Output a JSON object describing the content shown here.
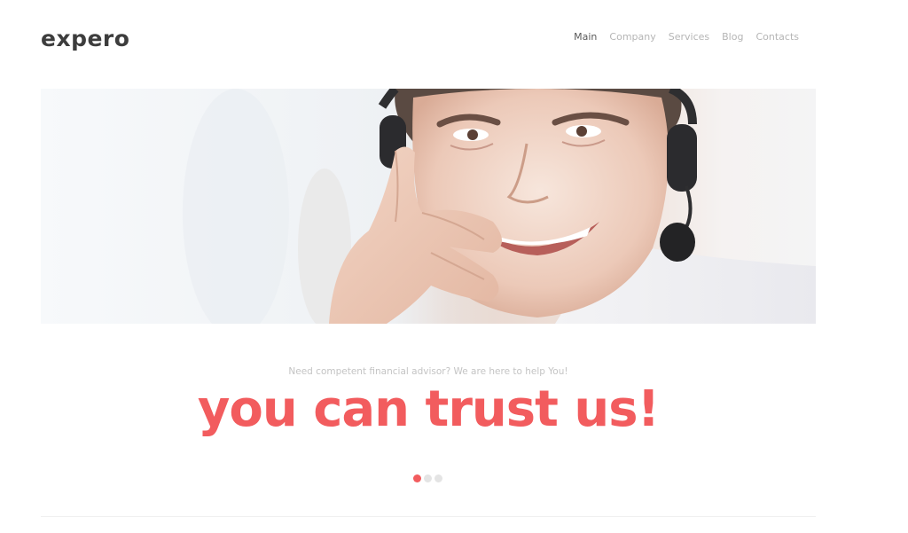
{
  "header": {
    "logo_text": "expero",
    "nav": [
      {
        "label": "Main",
        "active": true
      },
      {
        "label": "Company",
        "active": false
      },
      {
        "label": "Services",
        "active": false
      },
      {
        "label": "Blog",
        "active": false
      },
      {
        "label": "Contacts",
        "active": false
      }
    ]
  },
  "hero": {
    "image_subject": "smiling-man-with-headset"
  },
  "slide": {
    "tagline": "Need competent financial advisor? We are here to help You!",
    "headline": "you can trust us!",
    "slides_total": 3,
    "current_slide": 1
  },
  "colors": {
    "accent": "#f25c5e",
    "logo": "#3d3d3d",
    "nav_active": "#5a5a5a",
    "nav_inactive": "#b5b5b5",
    "dot_inactive": "#e4e4e4"
  }
}
